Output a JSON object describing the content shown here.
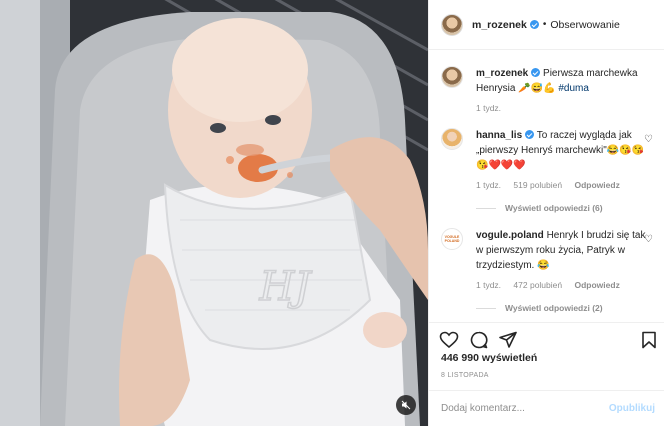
{
  "post": {
    "username": "m_rozenek",
    "separator": "•",
    "follow_label": "Obserwowanie",
    "caption_text": "Pierwsza marchewka Henrysia 🥕😅💪",
    "caption_hashtag": "#duma",
    "caption_time": "1 tydz."
  },
  "comments": [
    {
      "username": "hanna_lis",
      "text": "To raczej wygląda jak „pierwszy Henryś marchewki\"😂😘😘😘❤️❤️❤️",
      "time": "1 tydz.",
      "likes": "519 polubień",
      "reply": "Odpowiedz",
      "view_replies": "Wyświetl odpowiedzi (6)"
    },
    {
      "username": "vogule.poland",
      "avatar_text": "VOGULE POLAND",
      "text": "Henryk I brudzi się tak w pierwszym roku życia, Patryk w trzydziestym. 😂",
      "time": "1 tydz.",
      "likes": "472 polubień",
      "reply": "Odpowiedz",
      "view_replies": "Wyświetl odpowiedzi (2)"
    }
  ],
  "stats": {
    "views": "446 990 wyświetleń",
    "date": "8 LISTOPADA"
  },
  "composer": {
    "placeholder": "Dodaj komentarz...",
    "publish_label": "Opublikuj"
  },
  "colors": {
    "verified": "#3897f0",
    "link": "#00376b",
    "muted": "#8e8e8e",
    "publish_disabled": "#b3dbff"
  }
}
